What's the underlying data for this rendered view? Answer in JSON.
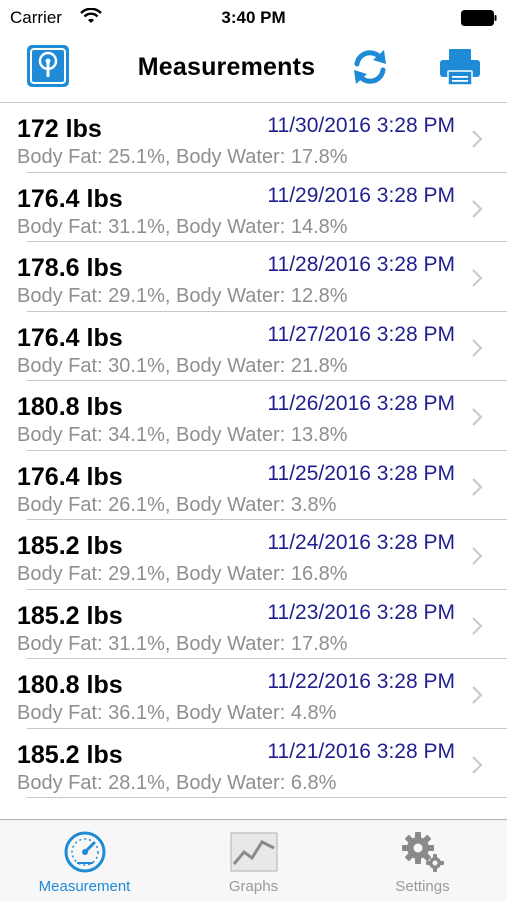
{
  "status": {
    "carrier": "Carrier",
    "time": "3:40 PM"
  },
  "header": {
    "title": "Measurements"
  },
  "colors": {
    "accent": "#1f8ad6",
    "date_text": "#1f1f8f",
    "secondary_text": "#8e8e93"
  },
  "icons": {
    "left": "scale-icon",
    "refresh": "refresh-icon",
    "print": "printer-icon",
    "disclosure": "chevron-right-icon"
  },
  "measurements": [
    {
      "weight": "172 lbs",
      "date": "11/30/2016 3:28 PM",
      "detail": "Body Fat: 25.1%, Body Water: 17.8%"
    },
    {
      "weight": "176.4 lbs",
      "date": "11/29/2016 3:28 PM",
      "detail": "Body Fat: 31.1%, Body Water: 14.8%"
    },
    {
      "weight": "178.6 lbs",
      "date": "11/28/2016 3:28 PM",
      "detail": "Body Fat: 29.1%, Body Water: 12.8%"
    },
    {
      "weight": "176.4 lbs",
      "date": "11/27/2016 3:28 PM",
      "detail": "Body Fat: 30.1%, Body Water: 21.8%"
    },
    {
      "weight": "180.8 lbs",
      "date": "11/26/2016 3:28 PM",
      "detail": "Body Fat: 34.1%, Body Water: 13.8%"
    },
    {
      "weight": "176.4 lbs",
      "date": "11/25/2016 3:28 PM",
      "detail": "Body Fat: 26.1%, Body Water: 3.8%"
    },
    {
      "weight": "185.2 lbs",
      "date": "11/24/2016 3:28 PM",
      "detail": "Body Fat: 29.1%, Body Water: 16.8%"
    },
    {
      "weight": "185.2 lbs",
      "date": "11/23/2016 3:28 PM",
      "detail": "Body Fat: 31.1%, Body Water: 17.8%"
    },
    {
      "weight": "180.8 lbs",
      "date": "11/22/2016 3:28 PM",
      "detail": "Body Fat: 36.1%, Body Water: 4.8%"
    },
    {
      "weight": "185.2 lbs",
      "date": "11/21/2016 3:28 PM",
      "detail": "Body Fat: 28.1%, Body Water: 6.8%"
    }
  ],
  "tabs": [
    {
      "label": "Measurement",
      "icon": "gauge-icon",
      "active": true
    },
    {
      "label": "Graphs",
      "icon": "chart-icon",
      "active": false
    },
    {
      "label": "Settings",
      "icon": "gears-icon",
      "active": false
    }
  ]
}
